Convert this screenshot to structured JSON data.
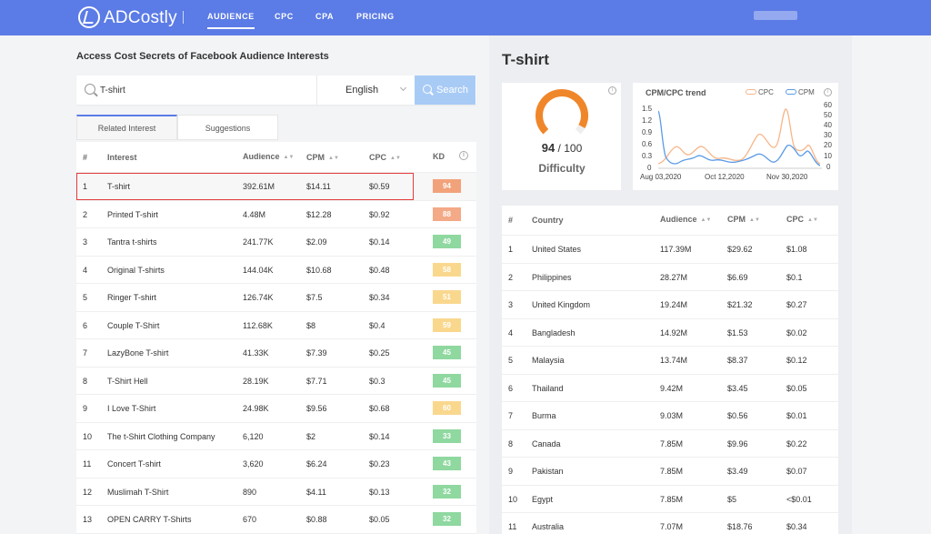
{
  "nav": {
    "brand": "ADCostly",
    "items": [
      "AUDIENCE",
      "CPC",
      "CPA",
      "PRICING"
    ]
  },
  "page_title": "Access Cost Secrets of Facebook Audience Interests",
  "search": {
    "value": "T-shirt",
    "language": "English",
    "button": "Search"
  },
  "tabs": [
    "Related Interest",
    "Suggestions"
  ],
  "left_table": {
    "headers": [
      "#",
      "Interest",
      "Audience",
      "CPM",
      "CPC",
      "KD"
    ],
    "rows": [
      {
        "n": "1",
        "interest": "T-shirt",
        "audience": "392.61M",
        "cpm": "$14.11",
        "cpc": "$0.59",
        "kd": "94",
        "kd_color": "#f2a27b"
      },
      {
        "n": "2",
        "interest": "Printed T-shirt",
        "audience": "4.48M",
        "cpm": "$12.28",
        "cpc": "$0.92",
        "kd": "88",
        "kd_color": "#f4a987"
      },
      {
        "n": "3",
        "interest": "Tantra t-shirts",
        "audience": "241.77K",
        "cpm": "$2.09",
        "cpc": "$0.14",
        "kd": "49",
        "kd_color": "#8fd8a0"
      },
      {
        "n": "4",
        "interest": "Original T-shirts",
        "audience": "144.04K",
        "cpm": "$10.68",
        "cpc": "$0.48",
        "kd": "58",
        "kd_color": "#f9d88e"
      },
      {
        "n": "5",
        "interest": "Ringer T-shirt",
        "audience": "126.74K",
        "cpm": "$7.5",
        "cpc": "$0.34",
        "kd": "51",
        "kd_color": "#f9d88e"
      },
      {
        "n": "6",
        "interest": "Couple T-Shirt",
        "audience": "112.68K",
        "cpm": "$8",
        "cpc": "$0.4",
        "kd": "59",
        "kd_color": "#f9d88e"
      },
      {
        "n": "7",
        "interest": "LazyBone T-shirt",
        "audience": "41.33K",
        "cpm": "$7.39",
        "cpc": "$0.25",
        "kd": "45",
        "kd_color": "#8fd8a0"
      },
      {
        "n": "8",
        "interest": "T-Shirt Hell",
        "audience": "28.19K",
        "cpm": "$7.71",
        "cpc": "$0.3",
        "kd": "45",
        "kd_color": "#8fd8a0"
      },
      {
        "n": "9",
        "interest": "I Love T-Shirt",
        "audience": "24.98K",
        "cpm": "$9.56",
        "cpc": "$0.68",
        "kd": "60",
        "kd_color": "#f9d88e"
      },
      {
        "n": "10",
        "interest": "The t-Shirt Clothing Company",
        "audience": "6,120",
        "cpm": "$2",
        "cpc": "$0.14",
        "kd": "33",
        "kd_color": "#8fd8a0"
      },
      {
        "n": "11",
        "interest": "Concert T-shirt",
        "audience": "3,620",
        "cpm": "$6.24",
        "cpc": "$0.23",
        "kd": "43",
        "kd_color": "#8fd8a0"
      },
      {
        "n": "12",
        "interest": "Muslimah T-Shirt",
        "audience": "890",
        "cpm": "$4.11",
        "cpc": "$0.13",
        "kd": "32",
        "kd_color": "#8fd8a0"
      },
      {
        "n": "13",
        "interest": "OPEN CARRY T-Shirts",
        "audience": "670",
        "cpm": "$0.88",
        "cpc": "$0.05",
        "kd": "32",
        "kd_color": "#8fd8a0"
      }
    ]
  },
  "detail": {
    "title": "T-shirt",
    "difficulty": {
      "score": "94",
      "out_of": "/ 100",
      "label": "Difficulty",
      "fraction": 0.94,
      "color": "#f0862a"
    },
    "trend": {
      "title": "CPM/CPC trend",
      "legend": [
        {
          "name": "CPC",
          "color": "#f6b68a"
        },
        {
          "name": "CPM",
          "color": "#5b9be6"
        }
      ],
      "y_left_ticks": [
        "1.5",
        "1.2",
        "0.9",
        "0.6",
        "0.3",
        "0"
      ],
      "y_right_ticks": [
        "60",
        "50",
        "40",
        "30",
        "20",
        "10",
        "0"
      ],
      "x_ticks": [
        "Aug 03,2020",
        "Oct 12,2020",
        "Nov 30,2020"
      ]
    },
    "country_table": {
      "headers": [
        "#",
        "Country",
        "Audience",
        "CPM",
        "CPC"
      ],
      "rows": [
        {
          "n": "1",
          "country": "United States",
          "audience": "117.39M",
          "cpm": "$29.62",
          "cpc": "$1.08"
        },
        {
          "n": "2",
          "country": "Philippines",
          "audience": "28.27M",
          "cpm": "$6.69",
          "cpc": "$0.1"
        },
        {
          "n": "3",
          "country": "United Kingdom",
          "audience": "19.24M",
          "cpm": "$21.32",
          "cpc": "$0.27"
        },
        {
          "n": "4",
          "country": "Bangladesh",
          "audience": "14.92M",
          "cpm": "$1.53",
          "cpc": "$0.02"
        },
        {
          "n": "5",
          "country": "Malaysia",
          "audience": "13.74M",
          "cpm": "$8.37",
          "cpc": "$0.12"
        },
        {
          "n": "6",
          "country": "Thailand",
          "audience": "9.42M",
          "cpm": "$3.45",
          "cpc": "$0.05"
        },
        {
          "n": "7",
          "country": "Burma",
          "audience": "9.03M",
          "cpm": "$0.56",
          "cpc": "$0.01"
        },
        {
          "n": "8",
          "country": "Canada",
          "audience": "7.85M",
          "cpm": "$9.96",
          "cpc": "$0.22"
        },
        {
          "n": "9",
          "country": "Pakistan",
          "audience": "7.85M",
          "cpm": "$3.49",
          "cpc": "$0.07"
        },
        {
          "n": "10",
          "country": "Egypt",
          "audience": "7.85M",
          "cpm": "$5",
          "cpc": "<$0.01"
        },
        {
          "n": "11",
          "country": "Australia",
          "audience": "7.07M",
          "cpm": "$18.76",
          "cpc": "$0.34"
        }
      ]
    }
  }
}
